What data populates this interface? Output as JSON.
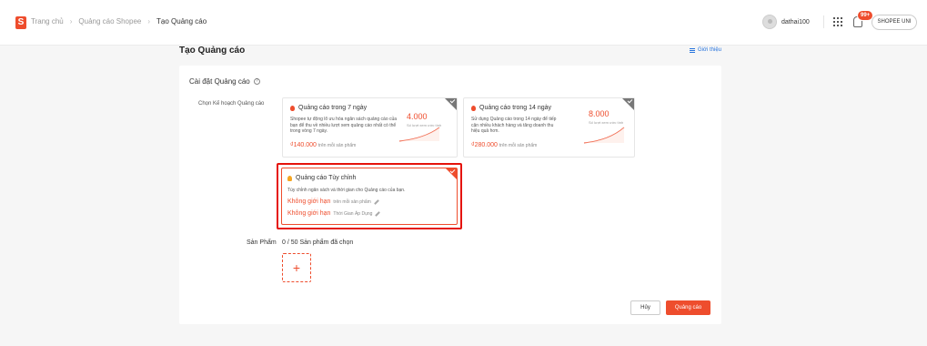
{
  "header": {
    "logo": "S",
    "breadcrumb": [
      "Trang chủ",
      "Quảng cáo Shopee",
      "Tạo Quảng cáo"
    ],
    "username": "dathai100",
    "notification_badge": "99+",
    "uni_button": "SHOPEE UNI"
  },
  "page": {
    "title": "Tạo Quảng cáo",
    "intro_link": "Giới thiệu"
  },
  "settings": {
    "section_title": "Cài đặt Quảng cáo",
    "plan_label": "Chọn Kế hoạch Quảng cáo",
    "plans": [
      {
        "title": "Quảng cáo trong 7 ngày",
        "description": "Shopee tự động lõ ưu hóa ngân sách quảng cáo của bạn để thu về nhiều lượt xem quảng cáo nhất có thể trong vòng 7 ngày.",
        "price": "₫140.000",
        "price_unit": "trên mỗi sản phẩm",
        "views": "4.000",
        "views_sub": "Số lượt xem ước tính"
      },
      {
        "title": "Quảng cáo trong 14 ngày",
        "description": "Sử dụng Quảng cáo trong 14 ngày để tiếp cận nhiều khách hàng và tăng doanh thu hiệu quả hơn.",
        "price": "₫280.000",
        "price_unit": "trên mỗi sản phẩm",
        "views": "8.000",
        "views_sub": "Số lượt xem ước tính"
      }
    ],
    "custom": {
      "title": "Quảng cáo Tùy chỉnh",
      "description": "Tùy chỉnh ngân sách và thời gian cho Quảng cáo của bạn.",
      "budget_value": "Không giới hạn",
      "budget_unit": "trên mỗi sản phẩm",
      "time_value": "Không giới hạn",
      "time_unit": "Thời Gian Áp Dụng"
    },
    "product_label": "Sản Phẩm",
    "product_count": "0 / 50 Sản phẩm đã chọn",
    "add_symbol": "+"
  },
  "actions": {
    "cancel": "Hủy",
    "submit": "Quảng cáo"
  },
  "colors": {
    "brand": "#ee4d2d",
    "highlight": "#e5130b",
    "link": "#2673dd"
  }
}
